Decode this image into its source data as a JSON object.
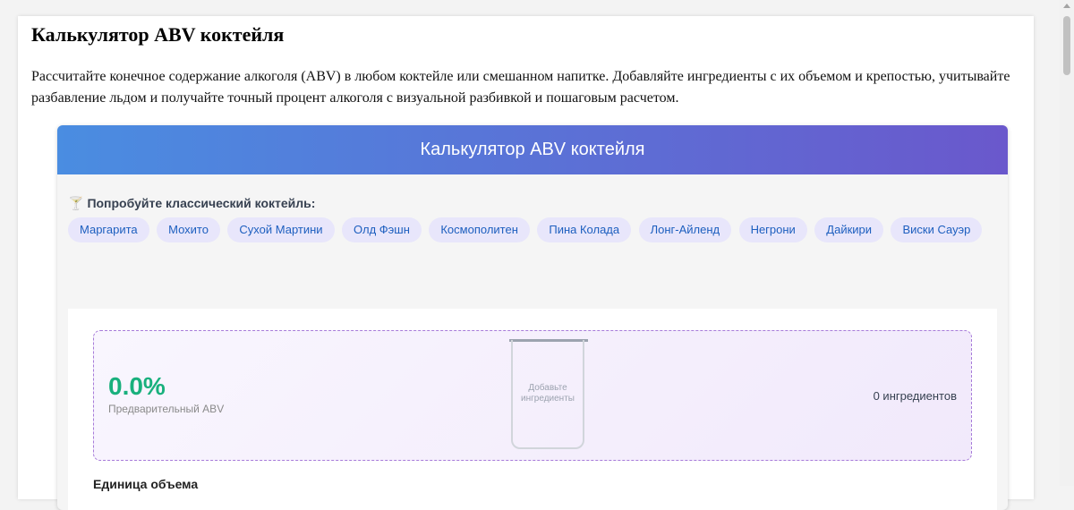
{
  "page": {
    "title": "Калькулятор ABV коктейля",
    "intro": "Рассчитайте конечное содержание алкоголя (ABV) в любом коктейле или смешанном напитке. Добавляйте ингредиенты с их объемом и крепостью, учитывайте разбавление льдом и получайте точный процент алкоголя с визуальной разбивкой и пошаговым расчетом."
  },
  "calculator": {
    "header_title": "Калькулятор ABV коктейля",
    "try_icon": "🍸",
    "try_label": "Попробуйте классический коктейль:",
    "presets": [
      "Маргарита",
      "Мохито",
      "Сухой Мартини",
      "Олд Фэшн",
      "Космополитен",
      "Пина Колада",
      "Лонг-Айленд",
      "Негрони",
      "Дайкири",
      "Виски Сауэр"
    ],
    "preview": {
      "abv_value": "0.0%",
      "abv_label": "Предварительный ABV",
      "glass_placeholder": "Добавьте ингредиенты",
      "ingredient_count": "0 ингредиентов"
    },
    "unit_label": "Единица объема"
  },
  "colors": {
    "header_gradient_start": "#4a8de1",
    "header_gradient_end": "#6a58cc",
    "abv_green": "#19b07d",
    "chip_bg": "#e8e6fb",
    "chip_text": "#1d5fbf"
  }
}
